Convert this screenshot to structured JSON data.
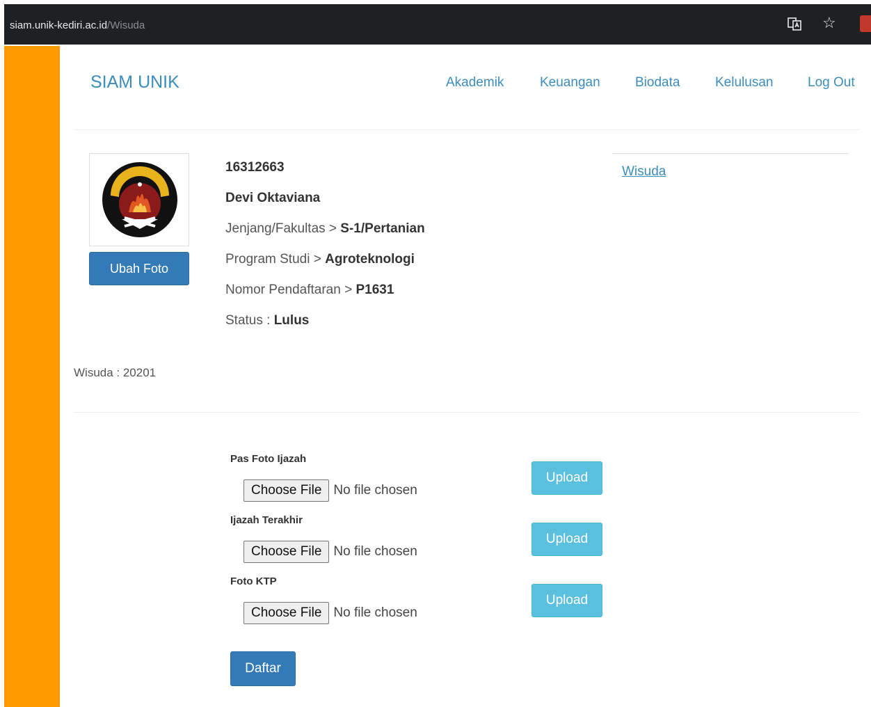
{
  "browser": {
    "url_domain": "siam.unik-kediri.ac.id",
    "url_path": "/Wisuda"
  },
  "navbar": {
    "brand": "SIAM UNIK",
    "items": [
      "Akademik",
      "Keuangan",
      "Biodata",
      "Kelulusan",
      "Log Out"
    ]
  },
  "profile": {
    "change_photo_label": "Ubah Foto",
    "nim": "16312663",
    "name": "Devi Oktaviana",
    "jenjang_label": "Jenjang/Fakultas > ",
    "jenjang_value": "S-1/Pertanian",
    "prodi_label": "Program Studi > ",
    "prodi_value": "Agroteknologi",
    "nomor_label": "Nomor Pendaftaran > ",
    "nomor_value": "P1631",
    "status_label": "Status : ",
    "status_value": "Lulus"
  },
  "side_panel": {
    "link": "Wisuda"
  },
  "wisuda_info": "Wisuda : 20201",
  "form": {
    "fields": [
      {
        "label": "Pas Foto Ijazah",
        "choose_label": "Choose File",
        "status": "No file chosen",
        "upload_label": "Upload"
      },
      {
        "label": "Ijazah Terakhir",
        "choose_label": "Choose File",
        "status": "No file chosen",
        "upload_label": "Upload"
      },
      {
        "label": "Foto KTP",
        "choose_label": "Choose File",
        "status": "No file chosen",
        "upload_label": "Upload"
      }
    ],
    "submit_label": "Daftar"
  },
  "colors": {
    "accent": "#3c8dbc",
    "sidebar": "#ff9900",
    "primary_button": "#337ab7",
    "info_button": "#5bc0de"
  }
}
